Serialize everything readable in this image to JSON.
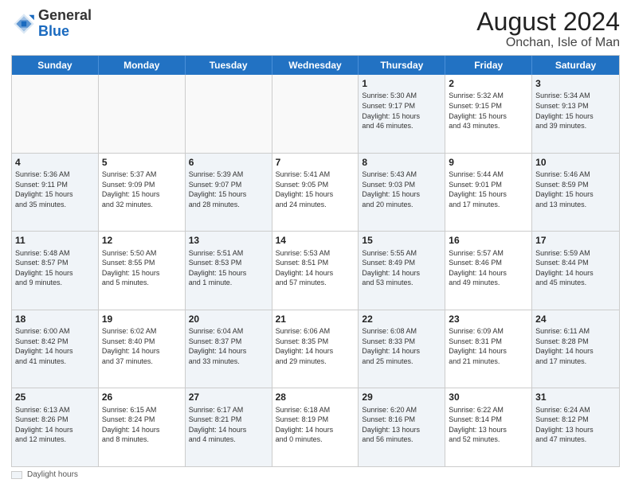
{
  "logo": {
    "general": "General",
    "blue": "Blue"
  },
  "title": "August 2024",
  "location": "Onchan, Isle of Man",
  "days_of_week": [
    "Sunday",
    "Monday",
    "Tuesday",
    "Wednesday",
    "Thursday",
    "Friday",
    "Saturday"
  ],
  "footer_label": "Daylight hours",
  "weeks": [
    [
      {
        "day": "",
        "info": ""
      },
      {
        "day": "",
        "info": ""
      },
      {
        "day": "",
        "info": ""
      },
      {
        "day": "",
        "info": ""
      },
      {
        "day": "1",
        "info": "Sunrise: 5:30 AM\nSunset: 9:17 PM\nDaylight: 15 hours\nand 46 minutes."
      },
      {
        "day": "2",
        "info": "Sunrise: 5:32 AM\nSunset: 9:15 PM\nDaylight: 15 hours\nand 43 minutes."
      },
      {
        "day": "3",
        "info": "Sunrise: 5:34 AM\nSunset: 9:13 PM\nDaylight: 15 hours\nand 39 minutes."
      }
    ],
    [
      {
        "day": "4",
        "info": "Sunrise: 5:36 AM\nSunset: 9:11 PM\nDaylight: 15 hours\nand 35 minutes."
      },
      {
        "day": "5",
        "info": "Sunrise: 5:37 AM\nSunset: 9:09 PM\nDaylight: 15 hours\nand 32 minutes."
      },
      {
        "day": "6",
        "info": "Sunrise: 5:39 AM\nSunset: 9:07 PM\nDaylight: 15 hours\nand 28 minutes."
      },
      {
        "day": "7",
        "info": "Sunrise: 5:41 AM\nSunset: 9:05 PM\nDaylight: 15 hours\nand 24 minutes."
      },
      {
        "day": "8",
        "info": "Sunrise: 5:43 AM\nSunset: 9:03 PM\nDaylight: 15 hours\nand 20 minutes."
      },
      {
        "day": "9",
        "info": "Sunrise: 5:44 AM\nSunset: 9:01 PM\nDaylight: 15 hours\nand 17 minutes."
      },
      {
        "day": "10",
        "info": "Sunrise: 5:46 AM\nSunset: 8:59 PM\nDaylight: 15 hours\nand 13 minutes."
      }
    ],
    [
      {
        "day": "11",
        "info": "Sunrise: 5:48 AM\nSunset: 8:57 PM\nDaylight: 15 hours\nand 9 minutes."
      },
      {
        "day": "12",
        "info": "Sunrise: 5:50 AM\nSunset: 8:55 PM\nDaylight: 15 hours\nand 5 minutes."
      },
      {
        "day": "13",
        "info": "Sunrise: 5:51 AM\nSunset: 8:53 PM\nDaylight: 15 hours\nand 1 minute."
      },
      {
        "day": "14",
        "info": "Sunrise: 5:53 AM\nSunset: 8:51 PM\nDaylight: 14 hours\nand 57 minutes."
      },
      {
        "day": "15",
        "info": "Sunrise: 5:55 AM\nSunset: 8:49 PM\nDaylight: 14 hours\nand 53 minutes."
      },
      {
        "day": "16",
        "info": "Sunrise: 5:57 AM\nSunset: 8:46 PM\nDaylight: 14 hours\nand 49 minutes."
      },
      {
        "day": "17",
        "info": "Sunrise: 5:59 AM\nSunset: 8:44 PM\nDaylight: 14 hours\nand 45 minutes."
      }
    ],
    [
      {
        "day": "18",
        "info": "Sunrise: 6:00 AM\nSunset: 8:42 PM\nDaylight: 14 hours\nand 41 minutes."
      },
      {
        "day": "19",
        "info": "Sunrise: 6:02 AM\nSunset: 8:40 PM\nDaylight: 14 hours\nand 37 minutes."
      },
      {
        "day": "20",
        "info": "Sunrise: 6:04 AM\nSunset: 8:37 PM\nDaylight: 14 hours\nand 33 minutes."
      },
      {
        "day": "21",
        "info": "Sunrise: 6:06 AM\nSunset: 8:35 PM\nDaylight: 14 hours\nand 29 minutes."
      },
      {
        "day": "22",
        "info": "Sunrise: 6:08 AM\nSunset: 8:33 PM\nDaylight: 14 hours\nand 25 minutes."
      },
      {
        "day": "23",
        "info": "Sunrise: 6:09 AM\nSunset: 8:31 PM\nDaylight: 14 hours\nand 21 minutes."
      },
      {
        "day": "24",
        "info": "Sunrise: 6:11 AM\nSunset: 8:28 PM\nDaylight: 14 hours\nand 17 minutes."
      }
    ],
    [
      {
        "day": "25",
        "info": "Sunrise: 6:13 AM\nSunset: 8:26 PM\nDaylight: 14 hours\nand 12 minutes."
      },
      {
        "day": "26",
        "info": "Sunrise: 6:15 AM\nSunset: 8:24 PM\nDaylight: 14 hours\nand 8 minutes."
      },
      {
        "day": "27",
        "info": "Sunrise: 6:17 AM\nSunset: 8:21 PM\nDaylight: 14 hours\nand 4 minutes."
      },
      {
        "day": "28",
        "info": "Sunrise: 6:18 AM\nSunset: 8:19 PM\nDaylight: 14 hours\nand 0 minutes."
      },
      {
        "day": "29",
        "info": "Sunrise: 6:20 AM\nSunset: 8:16 PM\nDaylight: 13 hours\nand 56 minutes."
      },
      {
        "day": "30",
        "info": "Sunrise: 6:22 AM\nSunset: 8:14 PM\nDaylight: 13 hours\nand 52 minutes."
      },
      {
        "day": "31",
        "info": "Sunrise: 6:24 AM\nSunset: 8:12 PM\nDaylight: 13 hours\nand 47 minutes."
      }
    ]
  ]
}
